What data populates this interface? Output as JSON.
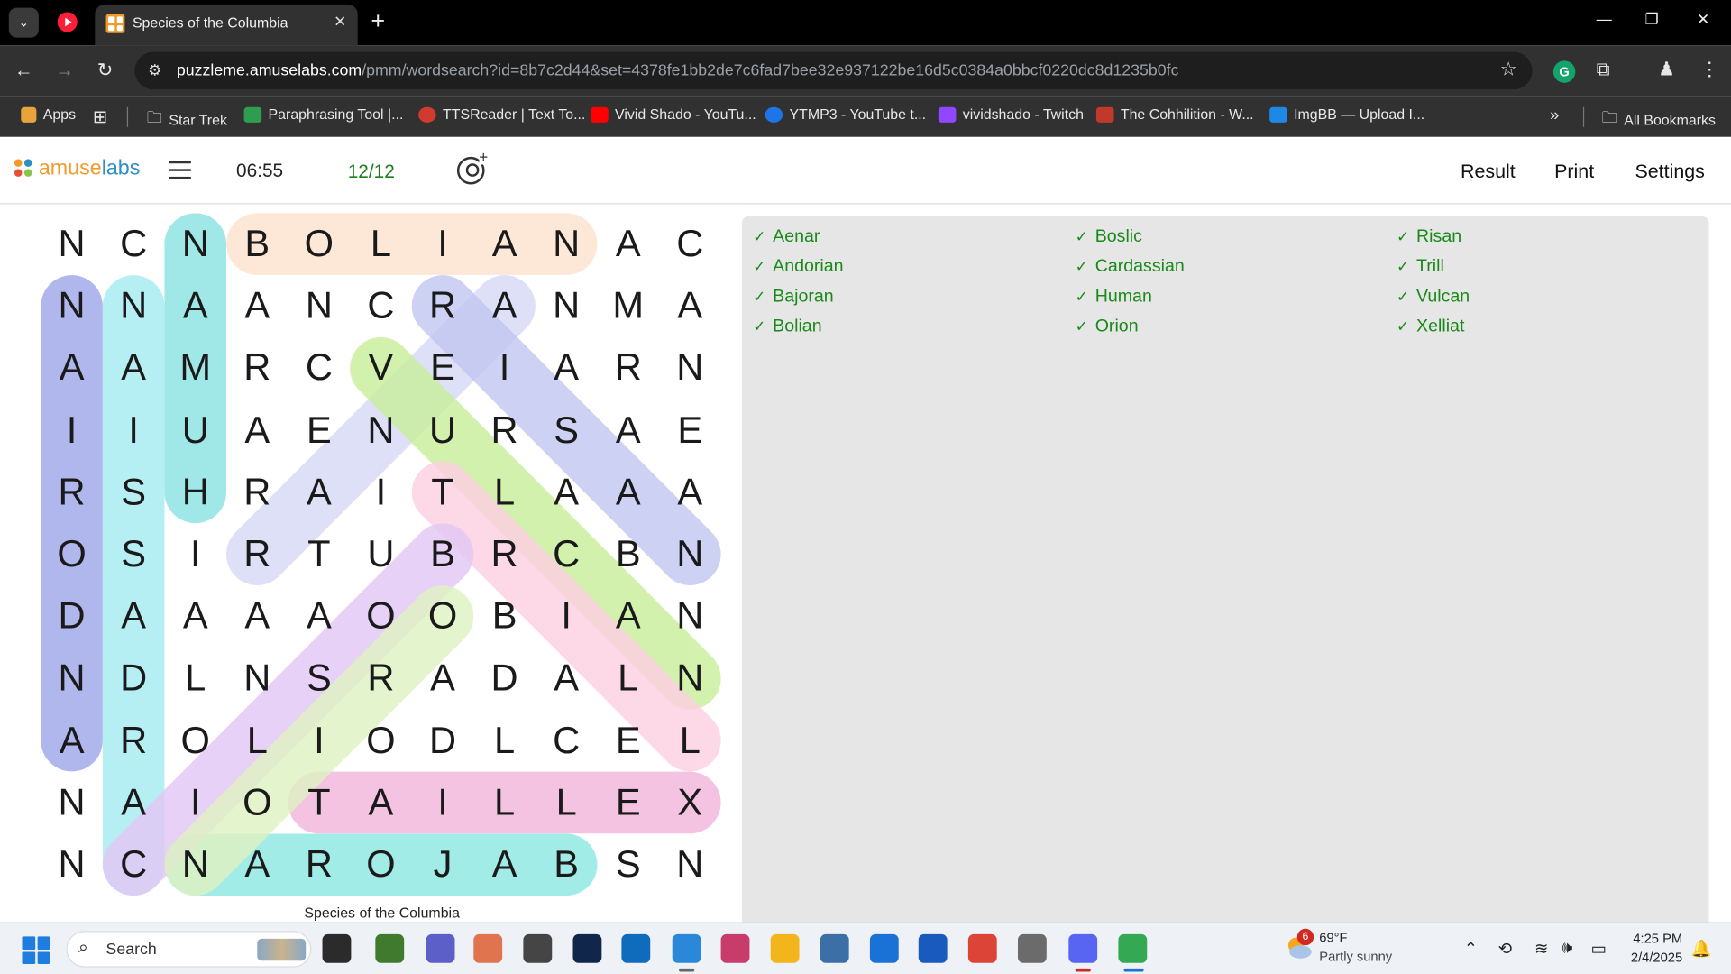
{
  "browser": {
    "tab_title": "Species of the Columbia",
    "url_host": "puzzleme.amuselabs.com",
    "url_path": "/pmm/wordsearch?id=8b7c2d44&set=4378fe1bb2de7c6fad7bee32e937122be16d5c0384a0bbcf0220dc8d1235b0fc",
    "bookmarks": [
      {
        "label": "Apps",
        "icon": "apps-grid-icon",
        "color": "#e8a33d"
      },
      {
        "label": "Star Trek",
        "icon": "folder-icon",
        "color": "#cfcfcf"
      },
      {
        "label": "Paraphrasing Tool |...",
        "icon": "quillbot-icon",
        "color": "#2e9d4f"
      },
      {
        "label": "TTSReader | Text To...",
        "icon": "speaker-icon",
        "color": "#d03a2f"
      },
      {
        "label": "Vivid Shado - YouTu...",
        "icon": "youtube-icon",
        "color": "#ff0000"
      },
      {
        "label": "YTMP3 - YouTube t...",
        "icon": "ytmp3-icon",
        "color": "#1e74e8"
      },
      {
        "label": "vividshado - Twitch",
        "icon": "twitch-icon",
        "color": "#9146ff"
      },
      {
        "label": "The Cohhilition - W...",
        "icon": "cohh-icon",
        "color": "#c0392b"
      },
      {
        "label": "ImgBB — Upload I...",
        "icon": "imgbb-icon",
        "color": "#1e88e5"
      }
    ],
    "all_bookmarks": "All Bookmarks"
  },
  "app": {
    "logo_part1": "amuse",
    "logo_part2": "labs",
    "timer": "06:55",
    "score": "12/12",
    "menu": [
      "Result",
      "Print",
      "Settings"
    ]
  },
  "puzzle": {
    "caption": "Species of the Columbia",
    "grid": [
      "NCNBOLIANAC",
      "NNAANCRANMA",
      "AAMRCVEIARN",
      "IIUAENURSAE",
      "RSHRAITLAAA",
      "OSIRTUBRCBN",
      "DAAAAOOBIAN",
      "NDLNSRADALN",
      "AROLIODLCEL",
      "NAIOTAILLEX",
      "NCNAROJABSN"
    ],
    "found": [
      {
        "word": "Bolian",
        "from": [
          0,
          3
        ],
        "to": [
          0,
          8
        ],
        "color": "#fde2cf"
      },
      {
        "word": "Andorian",
        "from": [
          8,
          0
        ],
        "to": [
          1,
          0
        ],
        "color": "#9fa8ea"
      },
      {
        "word": "Cardassian",
        "from": [
          10,
          1
        ],
        "to": [
          1,
          1
        ],
        "color": "#a6ecf2"
      },
      {
        "word": "Human",
        "from": [
          4,
          2
        ],
        "to": [
          0,
          2
        ],
        "color": "#8ce3e3"
      },
      {
        "word": "Bajoran",
        "from": [
          10,
          8
        ],
        "to": [
          10,
          2
        ],
        "color": "#8de8e2"
      },
      {
        "word": "Xelliat",
        "from": [
          9,
          10
        ],
        "to": [
          9,
          4
        ],
        "color": "#f2b6dc"
      },
      {
        "word": "Aenar",
        "from": [
          1,
          7
        ],
        "to": [
          5,
          3
        ],
        "color": "#d6daf5"
      },
      {
        "word": "Risan",
        "from": [
          1,
          6
        ],
        "to": [
          5,
          10
        ],
        "color": "#c3c7f2"
      },
      {
        "word": "Vulcan",
        "from": [
          2,
          5
        ],
        "to": [
          7,
          10
        ],
        "color": "#c8ef9c"
      },
      {
        "word": "Trill",
        "from": [
          4,
          6
        ],
        "to": [
          8,
          10
        ],
        "color": "#fdd0e2"
      },
      {
        "word": "Boslic",
        "from": [
          5,
          6
        ],
        "to": [
          10,
          1
        ],
        "color": "#e3c7f5"
      },
      {
        "word": "Orion",
        "from": [
          6,
          6
        ],
        "to": [
          10,
          2
        ],
        "color": "#dff2c3"
      }
    ]
  },
  "wordlist": {
    "col1": [
      "Aenar",
      "Andorian",
      "Bajoran",
      "Bolian"
    ],
    "col2": [
      "Boslic",
      "Cardassian",
      "Human",
      "Orion"
    ],
    "col3": [
      "Risan",
      "Trill",
      "Vulcan",
      "Xelliat"
    ]
  },
  "taskbar": {
    "search_label": "Search",
    "weather_badge": "6",
    "weather_temp": "69°F",
    "weather_desc": "Partly sunny",
    "time": "4:25 PM",
    "date": "2/4/2025",
    "apps": [
      {
        "name": "task-view-icon",
        "color": "#2b2b2b"
      },
      {
        "name": "minecraft-icon",
        "color": "#3f7a2f"
      },
      {
        "name": "teams-icon",
        "color": "#5b5fc7"
      },
      {
        "name": "copilot-icon",
        "color": "#e0744f"
      },
      {
        "name": "clock-app-icon",
        "color": "#454545"
      },
      {
        "name": "disney-plus-icon",
        "color": "#10264a"
      },
      {
        "name": "outlook-icon",
        "color": "#0f6cbd"
      },
      {
        "name": "notepad-icon",
        "color": "#2b88d8"
      },
      {
        "name": "snipping-tool-icon",
        "color": "#c83c6b"
      },
      {
        "name": "file-explorer-icon",
        "color": "#f2b61c"
      },
      {
        "name": "calculator-icon",
        "color": "#3b6fa6"
      },
      {
        "name": "calendar-icon",
        "color": "#1b72d6"
      },
      {
        "name": "word-icon",
        "color": "#185abd"
      },
      {
        "name": "chrome-icon",
        "color": "#db4437"
      },
      {
        "name": "mouse-app-icon",
        "color": "#6b6b6b"
      },
      {
        "name": "discord-icon",
        "color": "#5865f2"
      },
      {
        "name": "chrome-profile-icon",
        "color": "#34a853"
      }
    ]
  }
}
